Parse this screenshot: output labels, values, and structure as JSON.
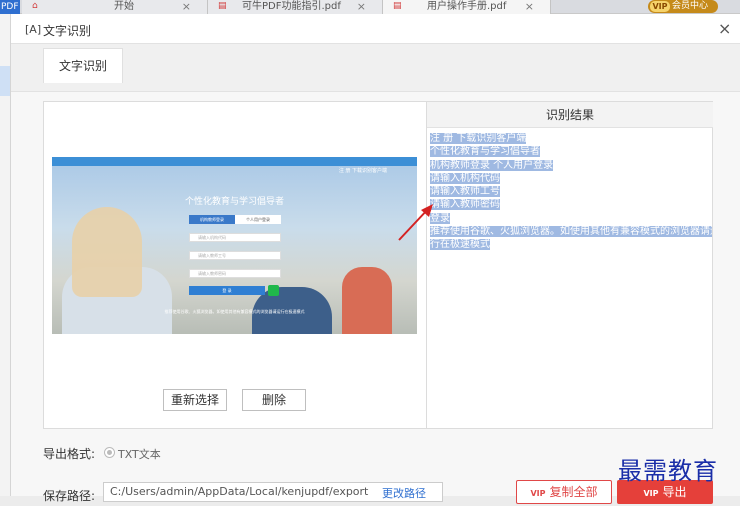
{
  "app": {
    "badge": "PDF"
  },
  "tabs": [
    {
      "icon": "⌂",
      "label": "开始",
      "close": "×"
    },
    {
      "icon": "▤",
      "label": "可牛PDF功能指引.pdf",
      "close": "×"
    },
    {
      "icon": "▤",
      "label": "用户操作手册.pdf",
      "close": "×"
    }
  ],
  "member": {
    "vip": "VIP",
    "label": "会员中心"
  },
  "dialog": {
    "title_icon": "[A]",
    "title": "文字识别",
    "close": "×",
    "tab_label": "文字识别"
  },
  "result": {
    "header": "识别结果",
    "lines": [
      "注 册 下载识别客户端",
      "个性化教育与学习倡导者",
      "机构教师登录 个人用户登录",
      "请输入机构代码",
      "请输入教师工号",
      "请输入教师密码",
      "登录",
      "推荐使用谷歌、火狐浏览器。如使用其他有兼容模式的浏览器请运",
      "行在极速模式"
    ]
  },
  "preview": {
    "topnav": "注 册    下载识别客户端",
    "title": "个性化教育与学习倡导者",
    "tab_a": "机构教师登录",
    "tab_b": "个人用户登录",
    "input1": "请输入机构代码",
    "input2": "请输入教师工号",
    "input3": "请输入教师密码",
    "login": "登 录",
    "footer": "推荐使用谷歌、火狐浏览器。如使用其他有兼容模式的浏览器请运行在极速模式"
  },
  "buttons": {
    "reselect": "重新选择",
    "delete": "删除",
    "copy_all": "复制全部",
    "export": "导出",
    "vip_mark": "VIP"
  },
  "export_format": {
    "label": "导出格式:",
    "value": "TXT文本"
  },
  "save_path": {
    "label": "保存路径:",
    "value": "C:/Users/admin/AppData/Local/kenjupdf/export",
    "change": "更改路径"
  },
  "watermark": "最需教育",
  "colors": {
    "accent": "#e5403a",
    "highlight": "#9fb9e2",
    "brand_blue": "#2f6fd0"
  }
}
